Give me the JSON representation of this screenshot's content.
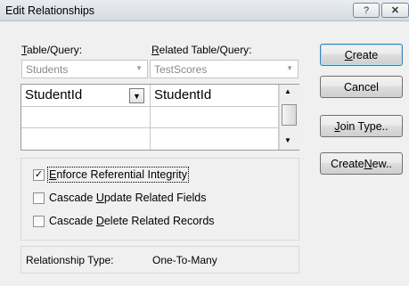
{
  "window": {
    "title": "Edit Relationships",
    "help_glyph": "?",
    "close_glyph": "✕"
  },
  "labels": {
    "table_query_pre": "",
    "table_query_key": "T",
    "table_query_post": "able/Query:",
    "related_pre": "",
    "related_key": "R",
    "related_post": "elated Table/Query:"
  },
  "combos": {
    "table": "Students",
    "related": "TestScores"
  },
  "grid": {
    "rows": [
      {
        "left": "StudentId",
        "right": "StudentId"
      },
      {
        "left": "",
        "right": ""
      },
      {
        "left": "",
        "right": ""
      }
    ]
  },
  "options": {
    "enforce": {
      "pre": "",
      "key": "E",
      "post": "nforce Referential Integrity",
      "checked": true
    },
    "cascade_update": {
      "pre": "Cascade ",
      "key": "U",
      "post": "pdate Related Fields",
      "checked": false
    },
    "cascade_delete": {
      "pre": "Cascade ",
      "key": "D",
      "post": "elete Related Records",
      "checked": false
    }
  },
  "relationship": {
    "label": "Relationship Type:",
    "value": "One-To-Many"
  },
  "buttons": {
    "create": {
      "pre": "",
      "key": "C",
      "post": "reate"
    },
    "cancel": {
      "pre": "Cancel",
      "key": "",
      "post": ""
    },
    "join": {
      "pre": "",
      "key": "J",
      "post": "oin Type.."
    },
    "create_new": {
      "pre": "Create ",
      "key": "N",
      "post": "ew.."
    }
  },
  "check_glyph": "✓",
  "colors": {
    "titlebar": "#dde2e9",
    "dialog_bg": "#f0f0f0",
    "default_button_border": "#3c7fb1"
  }
}
